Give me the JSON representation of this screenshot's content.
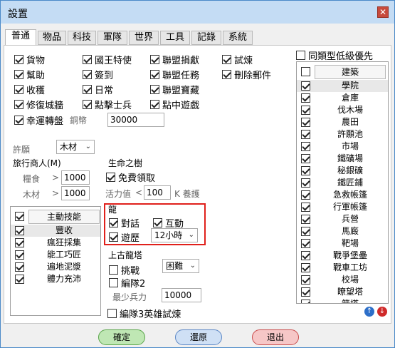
{
  "window": {
    "title": "設置",
    "close": "✕"
  },
  "tabs": [
    "普通",
    "物品",
    "科技",
    "軍隊",
    "世界",
    "工具",
    "記錄",
    "系統"
  ],
  "features": [
    {
      "label": "貨物",
      "checked": true
    },
    {
      "label": "國王特使",
      "checked": true
    },
    {
      "label": "聯盟捐獻",
      "checked": true
    },
    {
      "label": "試煉",
      "checked": true
    },
    {
      "label": "幫助",
      "checked": true
    },
    {
      "label": "簽到",
      "checked": true
    },
    {
      "label": "聯盟任務",
      "checked": true
    },
    {
      "label": "刪除郵件",
      "checked": true
    },
    {
      "label": "收穫",
      "checked": true
    },
    {
      "label": "日常",
      "checked": true
    },
    {
      "label": "聯盟寶藏",
      "checked": true
    },
    {
      "label": "修復城牆",
      "checked": true
    },
    {
      "label": "點擊士兵",
      "checked": true
    },
    {
      "label": "點中遊戲",
      "checked": true
    },
    {
      "label": "幸運轉盤",
      "checked": true
    }
  ],
  "copper": {
    "label": "銅幣",
    "value": "30000"
  },
  "wish": {
    "label": "許願",
    "value": "木材"
  },
  "merchant": {
    "title": "旅行商人(M)",
    "food_label": "糧食",
    "food_op": ">",
    "food_value": "1000",
    "wood_label": "木材",
    "wood_op": ">",
    "wood_value": "1000"
  },
  "life_tree": {
    "title": "生命之樹",
    "free_label": "免費領取",
    "free_checked": true,
    "stamina_label": "活力值",
    "stamina_op": "<",
    "stamina_value": "100",
    "feed_label": "K 養護"
  },
  "skills": {
    "header": "主動技能",
    "items": [
      {
        "label": "豐收",
        "checked": true
      },
      {
        "label": "瘋狂採集",
        "checked": true
      },
      {
        "label": "能工巧匠",
        "checked": true
      },
      {
        "label": "遍地泥漿",
        "checked": true
      },
      {
        "label": "體力充沛",
        "checked": true
      }
    ]
  },
  "dragon": {
    "title": "龍",
    "talk_label": "對話",
    "talk_checked": true,
    "interact_label": "互動",
    "interact_checked": true,
    "travel_label": "遊歷",
    "travel_checked": true,
    "hours": "12小時",
    "highlight_color": "#e0201b"
  },
  "ancient": {
    "title": "上古龍塔",
    "challenge_label": "挑戰",
    "difficulty": "困難",
    "team2_label": "編隊2",
    "min_troops_label": "最少兵力",
    "min_troops_value": "10000"
  },
  "team3_label": "編隊3英雄試煉",
  "same_type": "同類型低級優先",
  "buildings": {
    "header": "建築",
    "items": [
      "學院",
      "倉庫",
      "伐木場",
      "農田",
      "許願池",
      "市場",
      "鐵礦場",
      "秘銀礦",
      "鐵匠鋪",
      "急救帳篷",
      "行軍帳篷",
      "兵營",
      "馬廄",
      "靶場",
      "戰爭堡壘",
      "戰車工坊",
      "校場",
      "瞭望塔",
      "箭塔"
    ]
  },
  "buttons": {
    "ok": "確定",
    "reset": "還原",
    "exit": "退出"
  }
}
